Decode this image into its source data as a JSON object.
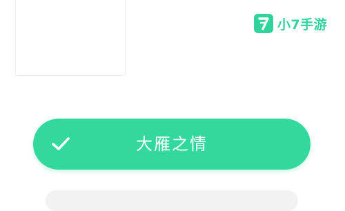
{
  "watermark": {
    "badge_glyph": "7",
    "text": "小7手游",
    "color": "#2fd49c"
  },
  "options": {
    "selected": {
      "label": "大雁之情",
      "icon": "check-icon",
      "color": "#33d89d",
      "checked": true
    }
  }
}
